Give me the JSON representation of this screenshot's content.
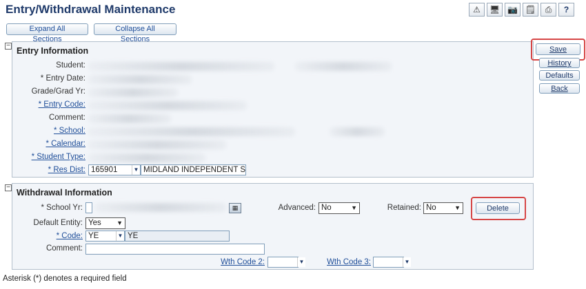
{
  "header": {
    "title": "Entry/Withdrawal Maintenance",
    "icons": [
      "warning-icon",
      "monitor-icon",
      "camera-icon",
      "notes-icon",
      "printer-icon",
      "help-icon"
    ],
    "help_label": "?"
  },
  "controls": {
    "expand_label": "Expand All Sections",
    "collapse_label": "Collapse All Sections"
  },
  "side": {
    "save_label": "Save",
    "history_label": "History",
    "defaults_label": "Defaults",
    "back_label": "Back"
  },
  "entry": {
    "title": "Entry Information",
    "student_label": "Student:",
    "entry_date_label": "* Entry Date:",
    "grade_label": "Grade/Grad Yr:",
    "entry_code_label": "* Entry Code:",
    "comment_label": "Comment:",
    "school_label": "* School:",
    "calendar_label": "* Calendar:",
    "student_type_label": "* Student Type:",
    "res_dist_label": "* Res Dist:",
    "res_dist_code": "165901",
    "res_dist_name": "MIDLAND INDEPENDENT SCHO"
  },
  "withdrawal": {
    "title": "Withdrawal Information",
    "school_yr_label": "* School Yr:",
    "advanced_label": "Advanced:",
    "advanced_value": "No",
    "retained_label": "Retained:",
    "retained_value": "No",
    "delete_label": "Delete",
    "default_entity_label": "Default Entity:",
    "default_entity_value": "Yes",
    "code_label": "* Code:",
    "code_value": "YE",
    "code_desc": "YE",
    "comment_label": "Comment:",
    "wth_code2_label": "Wth Code 2:",
    "wth_code3_label": "Wth Code 3:"
  },
  "footer": {
    "note": "Asterisk (*) denotes a required field"
  },
  "colors": {
    "title": "#1f3a6a",
    "link": "#1f4e99",
    "highlight": "#d64545",
    "section_bg": "#f2f5f9"
  }
}
